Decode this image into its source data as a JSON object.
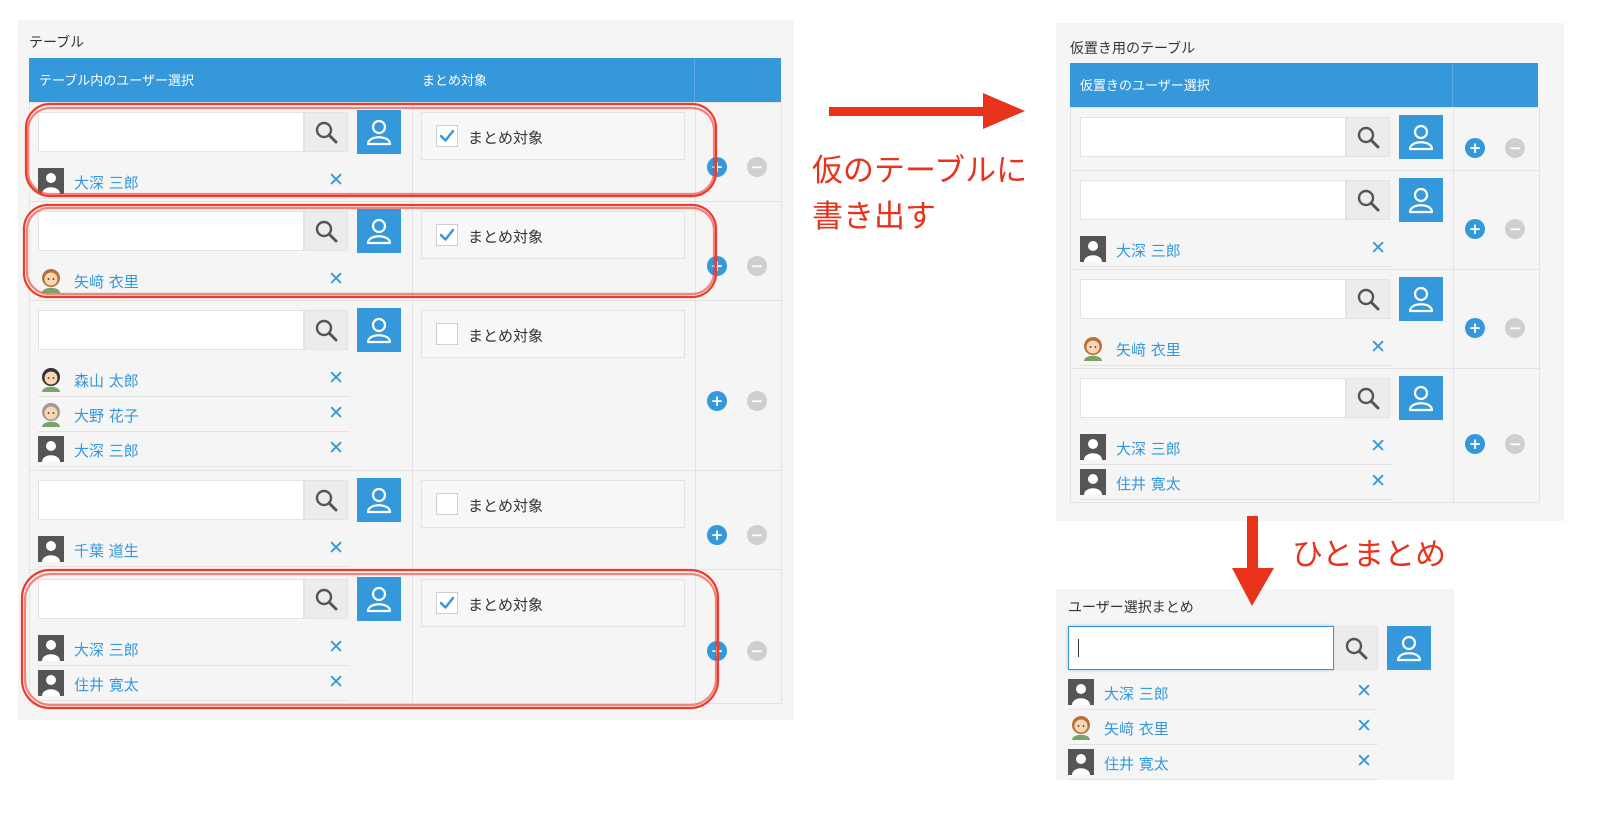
{
  "colors": {
    "accent": "#3498db",
    "annotation": "#e8321c",
    "panel": "#f5f5f5"
  },
  "icons": {
    "search": "search-icon",
    "user_select": "user-icon",
    "remove": "close-icon",
    "add_row": "plus-circle-icon",
    "remove_row": "minus-circle-icon",
    "avatar": "user-avatar-icon"
  },
  "main_table": {
    "title": "テーブル",
    "col_user": "テーブル内のユーザー選択",
    "col_target": "まとめ対象",
    "checkbox_label": "まとめ対象",
    "rows": [
      {
        "checked": true,
        "users": [
          {
            "name": "大深 三郎",
            "avatar": "silhouette"
          }
        ]
      },
      {
        "checked": true,
        "users": [
          {
            "name": "矢﨑 衣里",
            "avatar": "woman"
          }
        ]
      },
      {
        "checked": false,
        "users": [
          {
            "name": "森山 太郎",
            "avatar": "man"
          },
          {
            "name": "大野 花子",
            "avatar": "elder"
          },
          {
            "name": "大深 三郎",
            "avatar": "silhouette"
          }
        ]
      },
      {
        "checked": false,
        "users": [
          {
            "name": "千葉 道生",
            "avatar": "silhouette"
          }
        ]
      },
      {
        "checked": true,
        "users": [
          {
            "name": "大深 三郎",
            "avatar": "silhouette"
          },
          {
            "name": "住井 寛太",
            "avatar": "silhouette"
          }
        ]
      }
    ]
  },
  "temp_table": {
    "title": "仮置き用のテーブル",
    "col_user": "仮置きのユーザー選択",
    "rows": [
      {
        "users": []
      },
      {
        "users": [
          {
            "name": "大深 三郎",
            "avatar": "silhouette"
          }
        ]
      },
      {
        "users": [
          {
            "name": "矢﨑 衣里",
            "avatar": "woman"
          }
        ]
      },
      {
        "users": [
          {
            "name": "大深 三郎",
            "avatar": "silhouette"
          },
          {
            "name": "住井 寛太",
            "avatar": "silhouette"
          }
        ]
      }
    ]
  },
  "summary": {
    "title": "ユーザー選択まとめ",
    "input_value": "",
    "users": [
      {
        "name": "大深 三郎",
        "avatar": "silhouette"
      },
      {
        "name": "矢﨑 衣里",
        "avatar": "woman"
      },
      {
        "name": "住井 寛太",
        "avatar": "silhouette"
      }
    ]
  },
  "annotations": {
    "export_line1": "仮のテーブルに",
    "export_line2": "書き出す",
    "combine": "ひとまとめ"
  }
}
